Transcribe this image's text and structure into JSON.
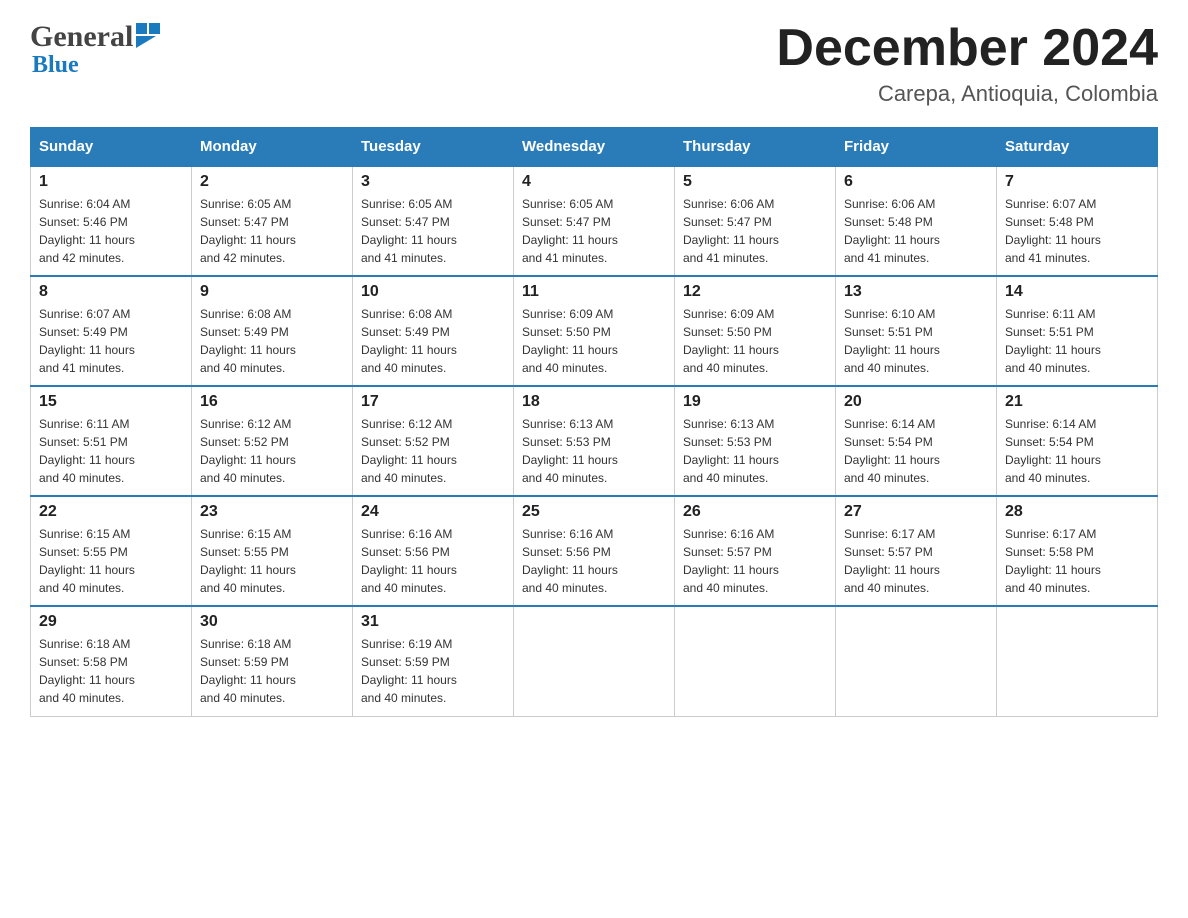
{
  "header": {
    "title": "December 2024",
    "subtitle": "Carepa, Antioquia, Colombia",
    "logo_general": "General",
    "logo_blue": "Blue"
  },
  "columns": [
    "Sunday",
    "Monday",
    "Tuesday",
    "Wednesday",
    "Thursday",
    "Friday",
    "Saturday"
  ],
  "weeks": [
    [
      {
        "day": "1",
        "sunrise": "6:04 AM",
        "sunset": "5:46 PM",
        "daylight": "11 hours and 42 minutes."
      },
      {
        "day": "2",
        "sunrise": "6:05 AM",
        "sunset": "5:47 PM",
        "daylight": "11 hours and 42 minutes."
      },
      {
        "day": "3",
        "sunrise": "6:05 AM",
        "sunset": "5:47 PM",
        "daylight": "11 hours and 41 minutes."
      },
      {
        "day": "4",
        "sunrise": "6:05 AM",
        "sunset": "5:47 PM",
        "daylight": "11 hours and 41 minutes."
      },
      {
        "day": "5",
        "sunrise": "6:06 AM",
        "sunset": "5:47 PM",
        "daylight": "11 hours and 41 minutes."
      },
      {
        "day": "6",
        "sunrise": "6:06 AM",
        "sunset": "5:48 PM",
        "daylight": "11 hours and 41 minutes."
      },
      {
        "day": "7",
        "sunrise": "6:07 AM",
        "sunset": "5:48 PM",
        "daylight": "11 hours and 41 minutes."
      }
    ],
    [
      {
        "day": "8",
        "sunrise": "6:07 AM",
        "sunset": "5:49 PM",
        "daylight": "11 hours and 41 minutes."
      },
      {
        "day": "9",
        "sunrise": "6:08 AM",
        "sunset": "5:49 PM",
        "daylight": "11 hours and 40 minutes."
      },
      {
        "day": "10",
        "sunrise": "6:08 AM",
        "sunset": "5:49 PM",
        "daylight": "11 hours and 40 minutes."
      },
      {
        "day": "11",
        "sunrise": "6:09 AM",
        "sunset": "5:50 PM",
        "daylight": "11 hours and 40 minutes."
      },
      {
        "day": "12",
        "sunrise": "6:09 AM",
        "sunset": "5:50 PM",
        "daylight": "11 hours and 40 minutes."
      },
      {
        "day": "13",
        "sunrise": "6:10 AM",
        "sunset": "5:51 PM",
        "daylight": "11 hours and 40 minutes."
      },
      {
        "day": "14",
        "sunrise": "6:11 AM",
        "sunset": "5:51 PM",
        "daylight": "11 hours and 40 minutes."
      }
    ],
    [
      {
        "day": "15",
        "sunrise": "6:11 AM",
        "sunset": "5:51 PM",
        "daylight": "11 hours and 40 minutes."
      },
      {
        "day": "16",
        "sunrise": "6:12 AM",
        "sunset": "5:52 PM",
        "daylight": "11 hours and 40 minutes."
      },
      {
        "day": "17",
        "sunrise": "6:12 AM",
        "sunset": "5:52 PM",
        "daylight": "11 hours and 40 minutes."
      },
      {
        "day": "18",
        "sunrise": "6:13 AM",
        "sunset": "5:53 PM",
        "daylight": "11 hours and 40 minutes."
      },
      {
        "day": "19",
        "sunrise": "6:13 AM",
        "sunset": "5:53 PM",
        "daylight": "11 hours and 40 minutes."
      },
      {
        "day": "20",
        "sunrise": "6:14 AM",
        "sunset": "5:54 PM",
        "daylight": "11 hours and 40 minutes."
      },
      {
        "day": "21",
        "sunrise": "6:14 AM",
        "sunset": "5:54 PM",
        "daylight": "11 hours and 40 minutes."
      }
    ],
    [
      {
        "day": "22",
        "sunrise": "6:15 AM",
        "sunset": "5:55 PM",
        "daylight": "11 hours and 40 minutes."
      },
      {
        "day": "23",
        "sunrise": "6:15 AM",
        "sunset": "5:55 PM",
        "daylight": "11 hours and 40 minutes."
      },
      {
        "day": "24",
        "sunrise": "6:16 AM",
        "sunset": "5:56 PM",
        "daylight": "11 hours and 40 minutes."
      },
      {
        "day": "25",
        "sunrise": "6:16 AM",
        "sunset": "5:56 PM",
        "daylight": "11 hours and 40 minutes."
      },
      {
        "day": "26",
        "sunrise": "6:16 AM",
        "sunset": "5:57 PM",
        "daylight": "11 hours and 40 minutes."
      },
      {
        "day": "27",
        "sunrise": "6:17 AM",
        "sunset": "5:57 PM",
        "daylight": "11 hours and 40 minutes."
      },
      {
        "day": "28",
        "sunrise": "6:17 AM",
        "sunset": "5:58 PM",
        "daylight": "11 hours and 40 minutes."
      }
    ],
    [
      {
        "day": "29",
        "sunrise": "6:18 AM",
        "sunset": "5:58 PM",
        "daylight": "11 hours and 40 minutes."
      },
      {
        "day": "30",
        "sunrise": "6:18 AM",
        "sunset": "5:59 PM",
        "daylight": "11 hours and 40 minutes."
      },
      {
        "day": "31",
        "sunrise": "6:19 AM",
        "sunset": "5:59 PM",
        "daylight": "11 hours and 40 minutes."
      },
      null,
      null,
      null,
      null
    ]
  ],
  "labels": {
    "sunrise": "Sunrise:",
    "sunset": "Sunset:",
    "daylight": "Daylight:"
  }
}
